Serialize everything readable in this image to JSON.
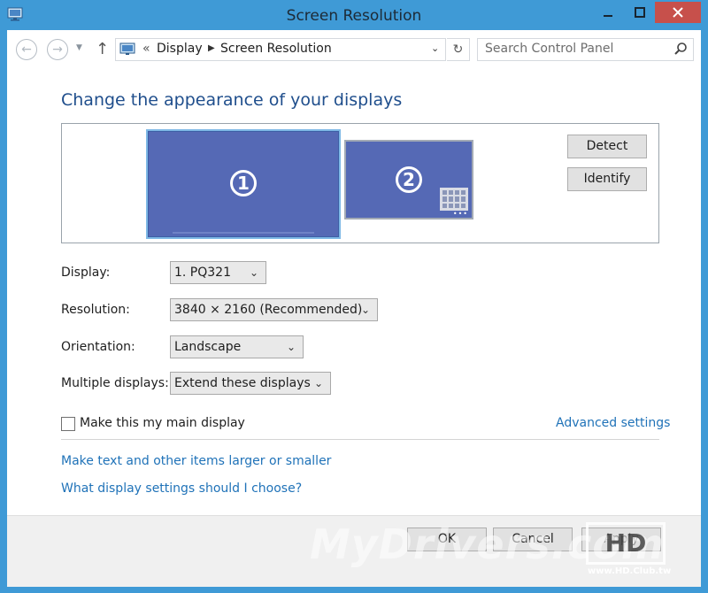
{
  "window": {
    "title": "Screen Resolution"
  },
  "addressbar": {
    "breadcrumbs": [
      "Display",
      "Screen Resolution"
    ],
    "search_placeholder": "Search Control Panel",
    "overflow_chevron": "«"
  },
  "content": {
    "heading": "Change the appearance of your displays",
    "monitors": [
      {
        "number": "1"
      },
      {
        "number": "2"
      }
    ],
    "detect_label": "Detect",
    "identify_label": "Identify",
    "display_label": "Display:",
    "display_value": "1. PQ321",
    "resolution_label": "Resolution:",
    "resolution_value": "3840 × 2160 (Recommended)",
    "orientation_label": "Orientation:",
    "orientation_value": "Landscape",
    "multiple_label": "Multiple displays:",
    "multiple_value": "Extend these displays",
    "main_display_label": "Make this my main display",
    "main_display_checked": false,
    "advanced_link": "Advanced settings",
    "link_text_size": "Make text and other items larger or smaller",
    "link_settings": "What display settings should I choose?"
  },
  "footer": {
    "ok_label": "OK",
    "cancel_label": "Cancel",
    "apply_label": "Apply"
  },
  "watermark": {
    "text": "MyDrivers.com",
    "logo": "HD",
    "url": "www.HD.Club.tw"
  },
  "colors": {
    "link": "#1f72b8",
    "heading": "#1f4e8c",
    "monitor": "#5569b5",
    "close": "#c7504b",
    "frame": "#3f9ad6"
  }
}
